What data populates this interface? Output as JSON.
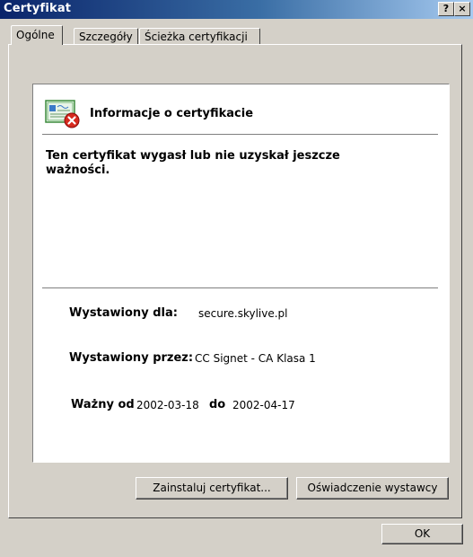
{
  "window": {
    "title": "Certyfikat",
    "help_button": "?",
    "close_button": "×"
  },
  "tabs": [
    {
      "label": "Ogólne",
      "active": true
    },
    {
      "label": "Szczegóły",
      "active": false
    },
    {
      "label": "Ścieżka certyfikacji",
      "active": false
    }
  ],
  "info": {
    "heading": "Informacje o certyfikacie",
    "message": "Ten certyfikat wygasł lub nie uzyskał jeszcze ważności."
  },
  "details": {
    "issued_to_label": "Wystawiony dla:",
    "issued_to_value": "secure.skylive.pl",
    "issued_by_label": "Wystawiony przez:",
    "issued_by_value": "CC Signet - CA Klasa 1",
    "valid_from_label": "Ważny od",
    "valid_from_value": "2002-03-18",
    "valid_to_label": "do",
    "valid_to_value": "2002-04-17"
  },
  "buttons": {
    "install": "Zainstaluj certyfikat...",
    "issuer_statement": "Oświadczenie wystawcy",
    "ok": "OK"
  },
  "icons": {
    "certificate": "certificate-icon",
    "error_badge": "error-x-icon"
  }
}
